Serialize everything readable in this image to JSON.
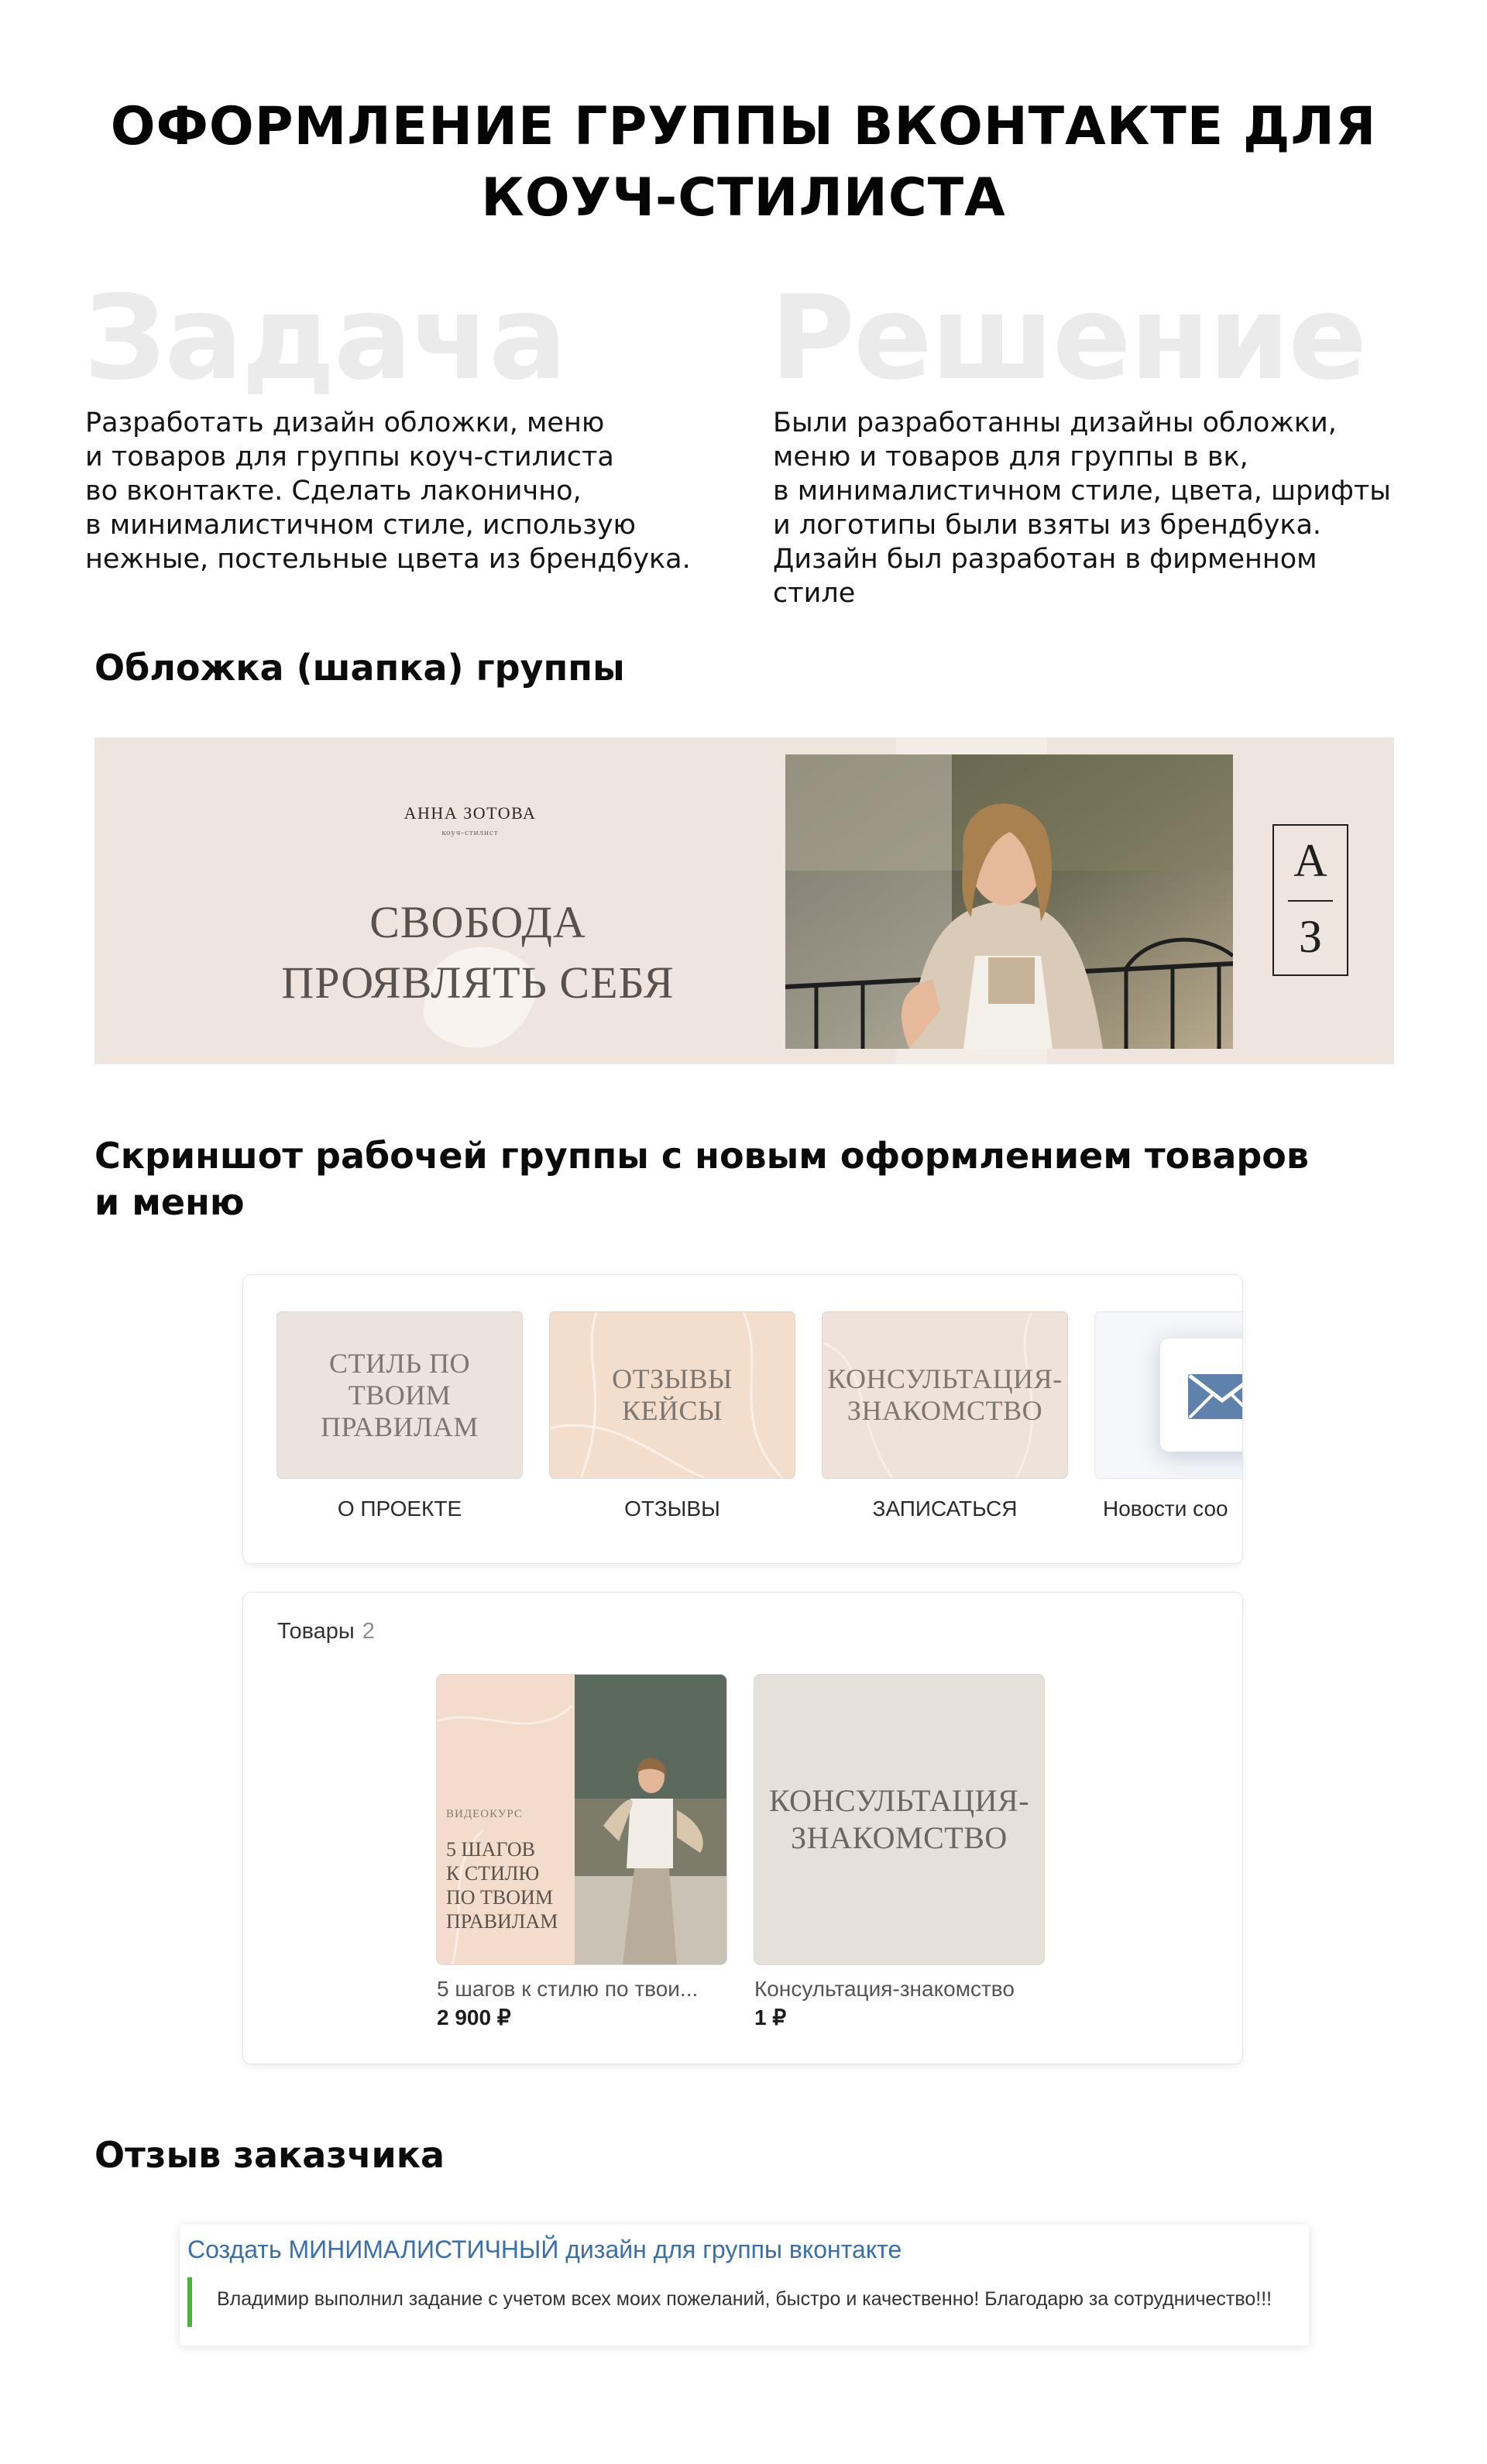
{
  "header": {
    "title_line1": "ОФОРМЛЕНИЕ ГРУППЫ ВКОНТАКТЕ ДЛЯ",
    "title_line2": "КОУЧ-СТИЛИСТА"
  },
  "task": {
    "heading": "Задача",
    "text": "Разработать дизайн обложки, меню\nи товаров для группы коуч-стилиста\nво вконтакте. Сделать лаконично,\nв минималистичном стиле, использую\nнежные, постельные цвета из брендбука."
  },
  "solution": {
    "heading": "Решение",
    "text": "Были разработанны дизайны обложки,\nменю и товаров для группы в вк,\nв минималистичном стиле, цвета, шрифты\nи логотипы были взяты из брендбука.\nДизайн был разработан в фирменном\nстиле"
  },
  "sections": {
    "cover_title": "Обложка (шапка) группы",
    "screenshot_title_line1": "Скриншот рабочей группы с новым оформлением товаров",
    "screenshot_title_line2": "и меню",
    "review_title": "Отзыв заказчика"
  },
  "cover": {
    "name": "АННА ЗОТОВА",
    "subtitle": "коуч-стилист",
    "slogan": "СВОБОДА\nПРОЯВЛЯТЬ СЕБЯ",
    "monogram_top": "А",
    "monogram_bottom": "З",
    "colors": {
      "background": "#efe5df",
      "slogan": "#57524e"
    }
  },
  "menu": {
    "items": [
      {
        "tile_text": "СТИЛЬ ПО\nТВОИМ\nПРАВИЛАМ",
        "label": "О ПРОЕКТЕ",
        "color": "#eae3de"
      },
      {
        "tile_text": "ОТЗЫВЫ\nКЕЙСЫ",
        "label": "ОТЗЫВЫ",
        "color": "#f3ddcc"
      },
      {
        "tile_text": "КОНСУЛЬТАЦИЯ-\nЗНАКОМСТВО",
        "label": "ЗАПИСАТЬСЯ",
        "color": "#efe2da"
      },
      {
        "tile_text": "",
        "label": "Новости соо",
        "icon": "envelope-icon"
      }
    ]
  },
  "goods": {
    "title": "Товары",
    "count": "2",
    "items": [
      {
        "kicker": "ВИДЕОКУРС",
        "card_title": "5 ШАГОВ\nК СТИЛЮ\nПО ТВОИМ\nПРАВИЛАМ",
        "name": "5 шагов к стилю по твои...",
        "price": "2 900 ₽"
      },
      {
        "card_title": "КОНСУЛЬТАЦИЯ-\nЗНАКОМСТВО",
        "name": "Консультация-знакомство",
        "price": "1 ₽"
      }
    ]
  },
  "review": {
    "link": "Создать МИНИМАЛИСТИЧНЫЙ дизайн для группы вконтакте",
    "text": "Владимир выполнил задание с учетом всех моих пожеланий, быстро и качественно! Благодарю за сотрудничество!!!",
    "colors": {
      "link": "#3a6fa8",
      "bar": "#4bb33c"
    }
  }
}
